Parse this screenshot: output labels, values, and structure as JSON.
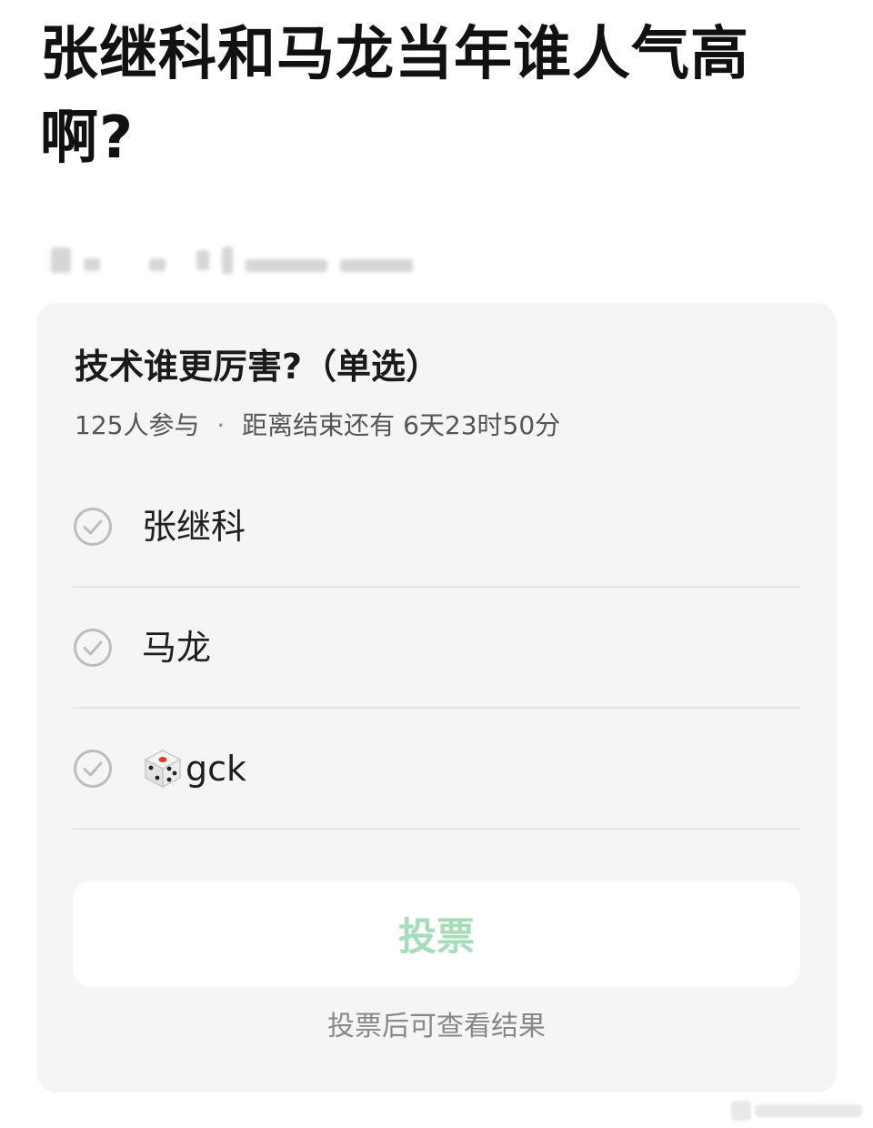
{
  "post": {
    "title": "张继科和马龙当年谁人气高啊?"
  },
  "poll": {
    "question": "技术谁更厉害?（单选）",
    "participants": "125人参与",
    "separator": "·",
    "time_remaining": "距离结束还有 6天23时50分",
    "options": [
      {
        "label": "张继科",
        "icon": "check-circle-icon"
      },
      {
        "label": "马龙",
        "icon": "check-circle-icon"
      },
      {
        "label": "gck",
        "icon": "check-circle-icon",
        "emoji_icon": "die-icon"
      }
    ],
    "vote_button_label": "投票",
    "hint": "投票后可查看结果"
  },
  "colors": {
    "card_background": "#f5f5f5",
    "vote_button_text": "#a8dcb8",
    "check_icon": "#bdbdbd",
    "divider": "#e3e3e3"
  }
}
